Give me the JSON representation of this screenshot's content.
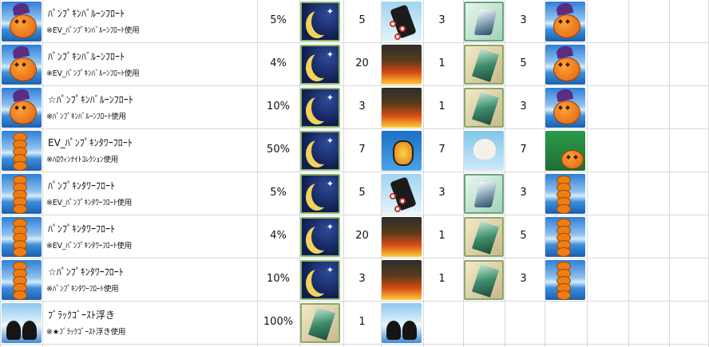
{
  "rows": [
    {
      "name": "ﾊﾟﾝﾌﾟｷﾝﾊﾞﾙｰﾝﾌﾛｰﾄ",
      "note": "※EV_ﾊﾟﾝﾌﾟｷﾝﾊﾞﾙｰﾝﾌﾛｰﾄ使用",
      "rate": "5%",
      "icon": "pumpkin-balloon-icon",
      "materials": [
        {
          "icon": "crescent-moon-icon",
          "count": "5"
        },
        {
          "icon": "black-cylinder-icon",
          "count": "3"
        },
        {
          "icon": "silver-shard-icon",
          "count": "3"
        }
      ],
      "result_icon": "pumpkin-balloon-icon"
    },
    {
      "name": "ﾊﾟﾝﾌﾟｷﾝﾊﾞﾙｰﾝﾌﾛｰﾄ",
      "note": "※EV_ﾊﾟﾝﾌﾟｷﾝﾊﾞﾙｰﾝﾌﾛｰﾄ使用",
      "rate": "4%",
      "icon": "pumpkin-balloon-icon",
      "materials": [
        {
          "icon": "crescent-moon-icon",
          "count": "20"
        },
        {
          "icon": "flame-icon",
          "count": "1"
        },
        {
          "icon": "green-crystal-icon",
          "count": "5"
        }
      ],
      "result_icon": "pumpkin-balloon-icon"
    },
    {
      "name": "☆ﾊﾟﾝﾌﾟｷﾝﾊﾞﾙｰﾝﾌﾛｰﾄ",
      "note": "※ﾊﾟﾝﾌﾟｷﾝﾊﾞﾙｰﾝﾌﾛｰﾄ使用",
      "rate": "10%",
      "icon": "pumpkin-balloon-icon",
      "materials": [
        {
          "icon": "crescent-moon-icon",
          "count": "3"
        },
        {
          "icon": "flame-icon",
          "count": "1"
        },
        {
          "icon": "green-crystal-icon",
          "count": "3"
        }
      ],
      "result_icon": "pumpkin-balloon-icon"
    },
    {
      "name": "EV_ﾊﾟﾝﾌﾟｷﾝﾀﾜｰﾌﾛｰﾄ",
      "note": "※ﾊﾛｳｨﾝﾅｲﾄｺﾚｸｼｮﾝ使用",
      "rate": "50%",
      "icon": "pumpkin-tower-icon",
      "materials": [
        {
          "icon": "crescent-moon-icon",
          "count": "7"
        },
        {
          "icon": "jack-lantern-icon",
          "count": "7"
        },
        {
          "icon": "skull-icon",
          "count": "7"
        }
      ],
      "result_icon": "halloween-book-icon"
    },
    {
      "name": "ﾊﾟﾝﾌﾟｷﾝﾀﾜｰﾌﾛｰﾄ",
      "note": "※EV_ﾊﾟﾝﾌﾟｷﾝﾀﾜｰﾌﾛｰﾄ使用",
      "rate": "5%",
      "icon": "pumpkin-tower-icon",
      "materials": [
        {
          "icon": "crescent-moon-icon",
          "count": "5"
        },
        {
          "icon": "black-cylinder-icon",
          "count": "3"
        },
        {
          "icon": "silver-shard-icon",
          "count": "3"
        }
      ],
      "result_icon": "pumpkin-tower-icon"
    },
    {
      "name": "ﾊﾟﾝﾌﾟｷﾝﾀﾜｰﾌﾛｰﾄ",
      "note": "※EV_ﾊﾟﾝﾌﾟｷﾝﾀﾜｰﾌﾛｰﾄ使用",
      "rate": "4%",
      "icon": "pumpkin-tower-icon",
      "materials": [
        {
          "icon": "crescent-moon-icon",
          "count": "20"
        },
        {
          "icon": "flame-icon",
          "count": "1"
        },
        {
          "icon": "green-crystal-icon",
          "count": "5"
        }
      ],
      "result_icon": "pumpkin-tower-icon"
    },
    {
      "name": "☆ﾊﾟﾝﾌﾟｷﾝﾀﾜｰﾌﾛｰﾄ",
      "note": "※ﾊﾟﾝﾌﾟｷﾝﾀﾜｰﾌﾛｰﾄ使用",
      "rate": "10%",
      "icon": "pumpkin-tower-icon",
      "materials": [
        {
          "icon": "crescent-moon-icon",
          "count": "3"
        },
        {
          "icon": "flame-icon",
          "count": "1"
        },
        {
          "icon": "green-crystal-icon",
          "count": "3"
        }
      ],
      "result_icon": "pumpkin-tower-icon"
    },
    {
      "name": "ﾌﾞﾗｯｸｺﾞｰｽﾄ浮き",
      "note": "※★ﾌﾞﾗｯｸｺﾞｰｽﾄ浮き使用",
      "rate": "100%",
      "icon": "black-ghost-icon",
      "materials": [
        {
          "icon": "green-crystal-icon",
          "count": "1"
        }
      ],
      "result_icon": "black-ghost-icon"
    }
  ]
}
